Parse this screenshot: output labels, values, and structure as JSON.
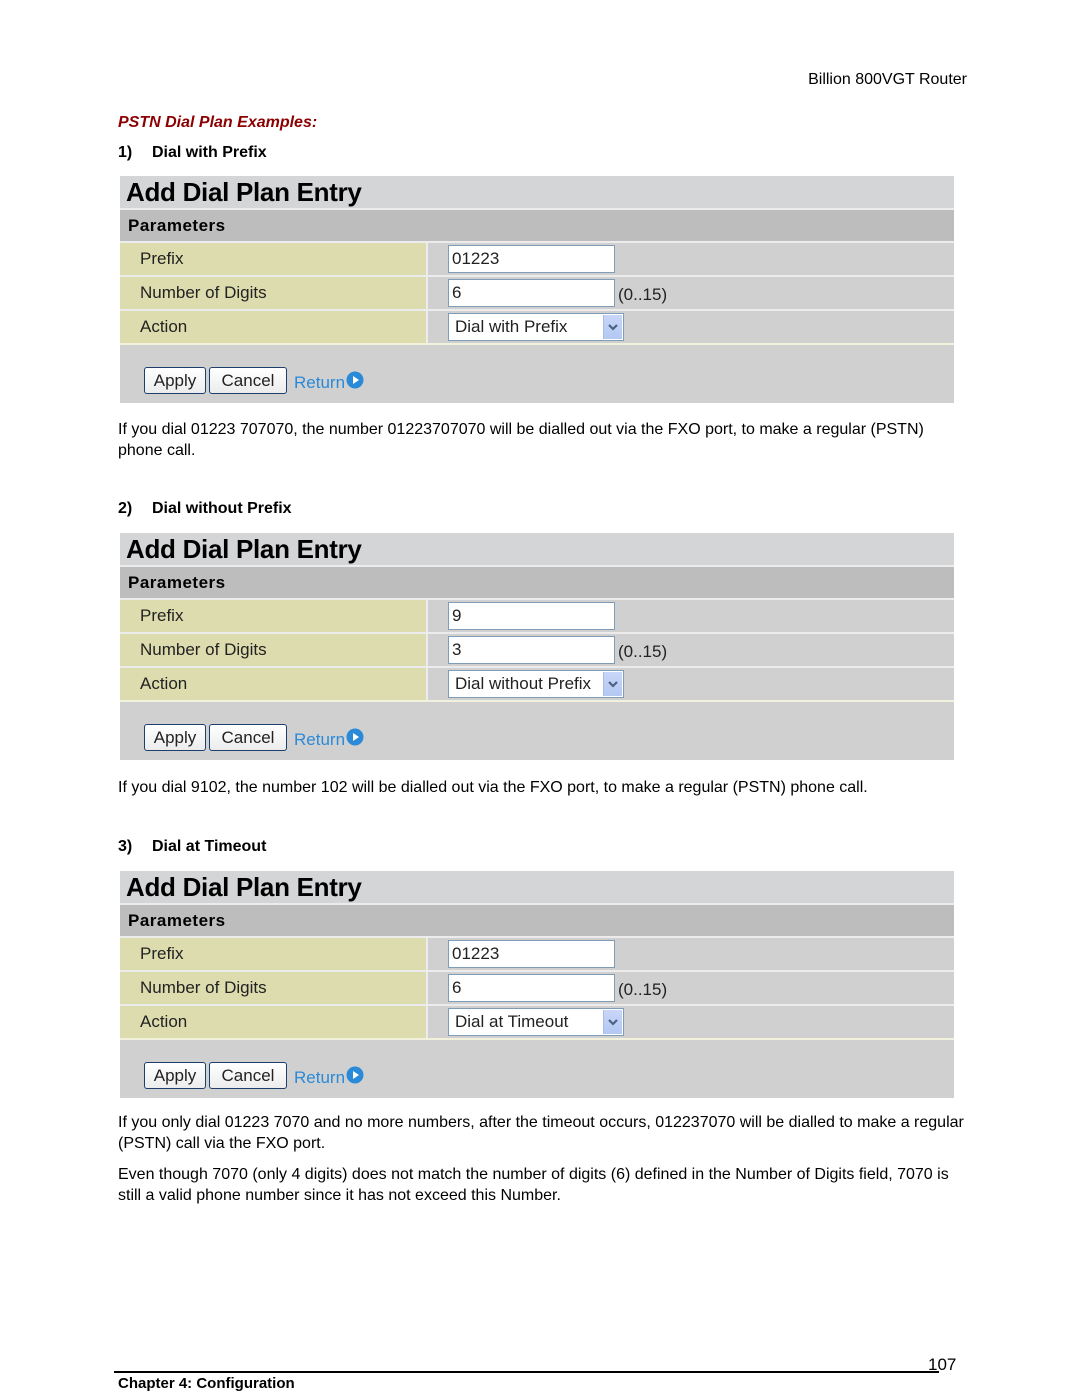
{
  "header": {
    "product": "Billion 800VGT Router"
  },
  "section_title": "PSTN Dial Plan Examples:",
  "panel_common": {
    "title": "Add Dial Plan Entry",
    "subtitle": "Parameters",
    "labels": {
      "prefix": "Prefix",
      "digits": "Number of Digits",
      "action": "Action"
    },
    "range_hint": "(0..15)",
    "apply_label": "Apply",
    "cancel_label": "Cancel",
    "return_label": "Return"
  },
  "examples": [
    {
      "number": "1)",
      "heading": "Dial with Prefix",
      "prefix": "01223",
      "digits": "6",
      "action": "Dial with Prefix",
      "description": "If you dial 01223 707070, the number 01223707070 will be dialled out via the FXO port, to make a regular (PSTN) phone call."
    },
    {
      "number": "2)",
      "heading": "Dial without Prefix",
      "prefix": "9",
      "digits": "3",
      "action": "Dial without Prefix",
      "description": "If you dial 9102, the number 102 will be dialled out via the FXO port, to make a regular (PSTN) phone call."
    },
    {
      "number": "3)",
      "heading": "Dial at Timeout",
      "prefix": "01223",
      "digits": "6",
      "action": "Dial at Timeout",
      "description": "If you only dial 01223 7070 and no more numbers, after the timeout occurs, 012237070 will be dialled to make a regular (PSTN) call via the FXO port.",
      "note": "Even though 7070 (only 4 digits) does not match the number of digits (6) defined in the Number of Digits field, 7070 is still a valid phone number since it has not exceed this Number."
    }
  ],
  "footer": {
    "page_number": "107",
    "chapter": "Chapter 4: Configuration"
  },
  "colors": {
    "section_title": "#8b0000",
    "return_link": "#2a8ad8",
    "label_cell": "#dcdcae",
    "panel_bg": "#d0d0d0"
  }
}
